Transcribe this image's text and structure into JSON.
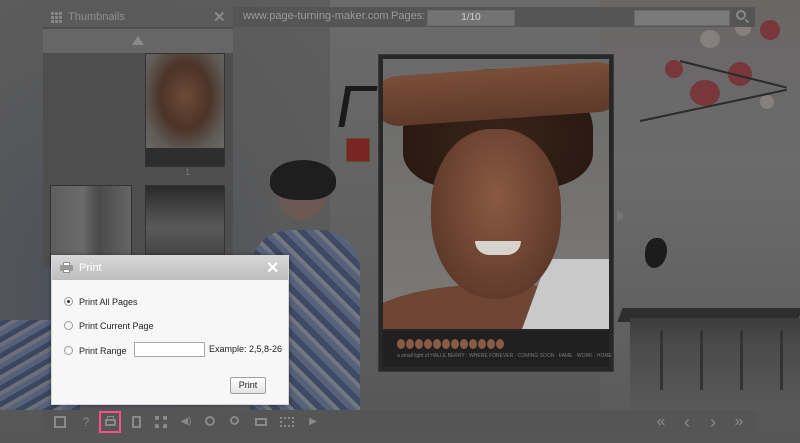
{
  "topbar": {
    "site": "www.page-turning-maker.com",
    "pages_label": "Pages:",
    "page_value": "1/10",
    "search_placeholder": ""
  },
  "thumbnails": {
    "title": "Thumbnails",
    "page_number": "1"
  },
  "page": {
    "caption": "a small light of HALLE BERRY · WHERE FOREVER · COMING SOON · FAME · WORK · HOME"
  },
  "print_dialog": {
    "title": "Print",
    "options": [
      {
        "label": "Print All Pages",
        "selected": true
      },
      {
        "label": "Print Current Page",
        "selected": false
      },
      {
        "label": "Print Range",
        "selected": false
      }
    ],
    "range_value": "",
    "example": "Example: 2,5,8-26",
    "print_button": "Print"
  },
  "toolbar": {
    "items": [
      {
        "name": "fullscreen-icon"
      },
      {
        "name": "help-icon",
        "glyph": "?"
      },
      {
        "name": "print-icon",
        "active": true
      },
      {
        "name": "document-icon"
      },
      {
        "name": "thumbnails-icon"
      },
      {
        "name": "sound-icon",
        "glyph": "◀)"
      },
      {
        "name": "zoom-in-icon"
      },
      {
        "name": "search-icon"
      },
      {
        "name": "email-icon"
      },
      {
        "name": "share-icon"
      },
      {
        "name": "autoplay-icon",
        "glyph": "▶"
      },
      {
        "name": "first-page-icon",
        "glyph": "«"
      },
      {
        "name": "previous-page-icon",
        "glyph": "‹"
      },
      {
        "name": "next-page-icon",
        "glyph": "›"
      },
      {
        "name": "last-page-icon",
        "glyph": "»"
      }
    ],
    "highlight_color": "#ff4f86"
  }
}
